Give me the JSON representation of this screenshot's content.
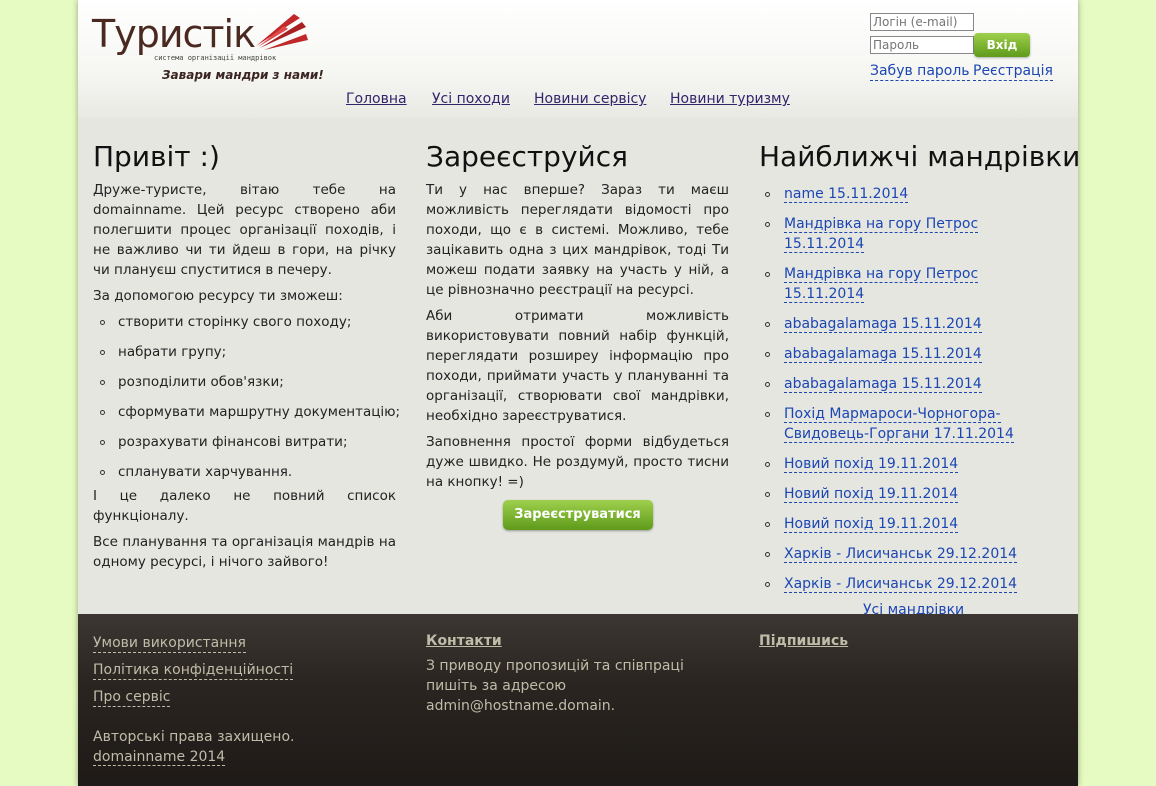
{
  "header": {
    "logo_title": "Туристік",
    "logo_subtitle": "система організації мандрівок",
    "logo_slogan": "Завари мандри з нами!"
  },
  "login": {
    "email_placeholder": "Логін (e-mail)",
    "password_placeholder": "Пароль",
    "submit_label": "Вхід",
    "forgot_label": "Забув пароль",
    "register_label": "Реєстрація"
  },
  "nav": [
    {
      "label": "Головна"
    },
    {
      "label": "Усі походи"
    },
    {
      "label": "Новини сервісу"
    },
    {
      "label": "Новини туризму"
    }
  ],
  "welcome": {
    "title": "Привіт :)",
    "intro": "Друже-туристе, вітаю тебе на domainname. Цей ресурс створено аби полегшити процес організації походів, і не важливо чи ти йдеш в гори, на річку чи плануєш спуститися в печеру.",
    "lead": "За допомогою ресурсу ти зможеш:",
    "features": [
      "створити сторінку свого походу;",
      "набрати групу;",
      "розподілити обов'язки;",
      "сформувати маршрутну документацію;",
      "розрахувати фінансові витрати;",
      "спланувати харчування."
    ],
    "outro1": "І це далеко не повний список функціоналу.",
    "outro2": "Все планування та організація мандрів на одному ресурсі, і нічого зайвого!"
  },
  "register": {
    "title": "Зареєструйся",
    "p1": "Ти у нас вперше? Зараз ти маєш можливість переглядати відомості про походи, що є в системі. Можливо, тебе зацікавить одна з цих мандрівок, тоді Ти можеш подати заявку на участь у ній, а це рівнозначно реєстрації на ресурсі.",
    "p2": "Аби отримати можливість використовувати повний набір функцій, переглядати розширеу інформацію про походи, приймати участь у плануванні та організації, створювати свої мандрівки, необхідно зареєструватися.",
    "p3": "Заповнення простої форми відбудеться дуже швидко. Не роздумуй, просто тисни на кнопку! =)",
    "button_label": "Зареєструватися"
  },
  "trips": {
    "title": "Найближчі мандрівки",
    "items": [
      "name 15.11.2014",
      "Мандрівка на гору Петрос 15.11.2014",
      "Мандрівка на гору Петрос 15.11.2014",
      "ababagalamaga 15.11.2014",
      "ababagalamaga 15.11.2014",
      "ababagalamaga 15.11.2014",
      "Похід Мармароси-Чорногора-Свидовець-Горгани 17.11.2014",
      "Новий похід 19.11.2014",
      "Новий похід 19.11.2014",
      "Новий похід 19.11.2014",
      "Харків - Лисичанськ 29.12.2014",
      "Харків - Лисичанськ 29.12.2014"
    ],
    "all_label": "Усі мандрівки"
  },
  "footer": {
    "links": [
      "Умови використання",
      "Політика конфіденційності",
      "Про сервіс"
    ],
    "copyright_line1": "Авторські права захищено.",
    "copyright_line2": "domainname 2014",
    "contacts_title": "Контакти",
    "contacts_text": "З приводу пропозицій та співпраці пишіть за адресою admin@hostname.domain.",
    "subscribe_title": "Підпишись"
  },
  "colors": {
    "page_background": "#e6fbc2",
    "content_background": "#e6e6e1",
    "link": "#1b46b3",
    "button_green": "#6aa71f",
    "footer_background": "#2a2521",
    "footer_text": "#bfbca8",
    "logo_red": "#c0282a"
  }
}
